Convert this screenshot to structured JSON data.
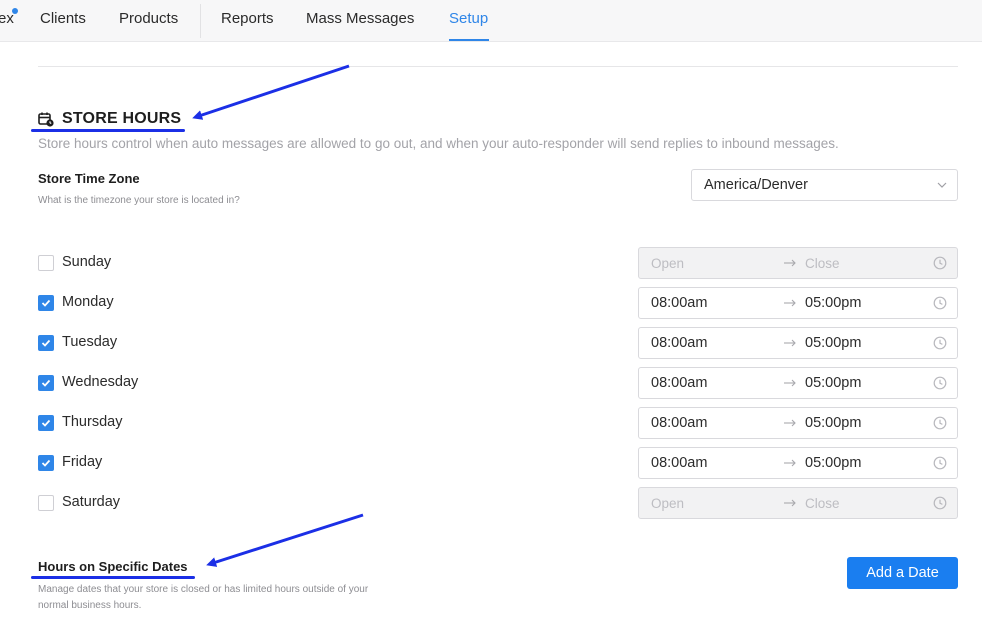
{
  "nav": {
    "partial_item": "ex",
    "items": [
      {
        "label": "Clients"
      },
      {
        "label": "Products"
      },
      {
        "label": "Reports"
      },
      {
        "label": "Mass Messages"
      },
      {
        "label": "Setup"
      }
    ]
  },
  "store_hours": {
    "title": "STORE HOURS",
    "description": "Store hours control when auto messages are allowed to go out, and when your auto-responder will send replies to inbound messages."
  },
  "timezone": {
    "label": "Store Time Zone",
    "help": "What is the timezone your store is located in?",
    "value": "America/Denver"
  },
  "days": [
    {
      "name": "Sunday",
      "checked": false,
      "open": "Open",
      "close": "Close"
    },
    {
      "name": "Monday",
      "checked": true,
      "open": "08:00am",
      "close": "05:00pm"
    },
    {
      "name": "Tuesday",
      "checked": true,
      "open": "08:00am",
      "close": "05:00pm"
    },
    {
      "name": "Wednesday",
      "checked": true,
      "open": "08:00am",
      "close": "05:00pm"
    },
    {
      "name": "Thursday",
      "checked": true,
      "open": "08:00am",
      "close": "05:00pm"
    },
    {
      "name": "Friday",
      "checked": true,
      "open": "08:00am",
      "close": "05:00pm"
    },
    {
      "name": "Saturday",
      "checked": false,
      "open": "Open",
      "close": "Close"
    }
  ],
  "specific_dates": {
    "label": "Hours on Specific Dates",
    "help_line1": "Manage dates that your store is closed or has limited hours outside of your",
    "help_line2": "normal business hours.",
    "add_button": "Add a Date"
  },
  "colors": {
    "accent": "#2f86e8",
    "button": "#1a7ef0",
    "annotation": "#1b2fe6"
  }
}
